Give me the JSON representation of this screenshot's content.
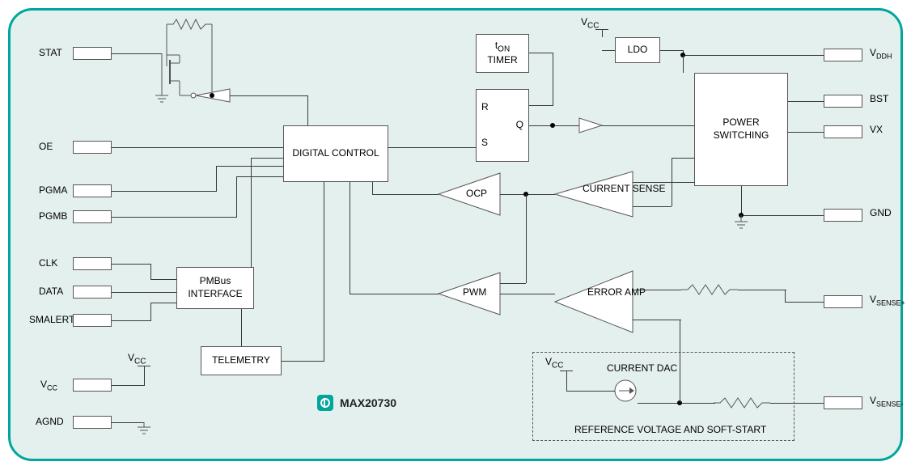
{
  "part_number": "MAX20730",
  "left_pins": {
    "stat": "STAT",
    "oe": "OE",
    "pgma": "PGMA",
    "pgmb": "PGMB",
    "clk": "CLK",
    "data": "DATA",
    "smalert": "SMALERT",
    "vcc": "V",
    "vcc_sub": "CC",
    "agnd": "AGND"
  },
  "right_pins": {
    "vddh": "V",
    "vddh_sub": "DDH",
    "bst": "BST",
    "vx": "VX",
    "gnd": "GND",
    "vsensep": "V",
    "vsensep_sub": "SENSE+",
    "vsensen": "V",
    "vsensen_sub": "SENSE-"
  },
  "blocks": {
    "digital_control": "DIGITAL CONTROL",
    "pmbus": "PMBus INTERFACE",
    "telemetry": "TELEMETRY",
    "ton": "t",
    "ton_sub": "ON",
    "ton_rest": "TIMER",
    "ocp": "OCP",
    "pwm": "PWM",
    "current_sense": "CURRENT SENSE",
    "error_amp": "ERROR AMP",
    "ldo": "LDO",
    "power_switching": "POWER SWITCHING",
    "current_dac": "CURRENT DAC",
    "ref_softstart": "REFERENCE VOLTAGE AND SOFT-START"
  },
  "flipflop": {
    "r": "R",
    "s": "S",
    "q": "Q"
  },
  "vcc_labels": {
    "ldo_vcc": "V",
    "ldo_vcc_sub": "CC",
    "dac_vcc": "V",
    "dac_vcc_sub": "CC",
    "left_vcc": "V",
    "left_vcc_sub": "CC"
  }
}
